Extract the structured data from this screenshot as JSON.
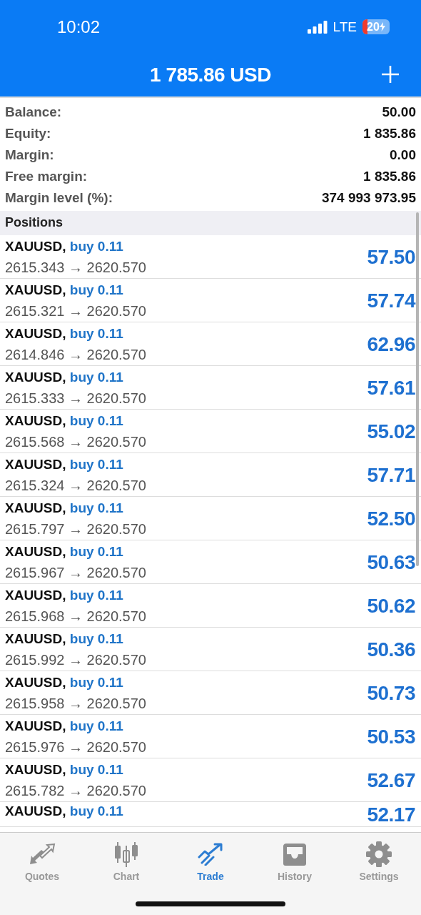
{
  "status_bar": {
    "time": "10:02",
    "network": "LTE",
    "battery": "20"
  },
  "header": {
    "title": "1 785.86 USD"
  },
  "account": [
    {
      "label": "Balance:",
      "value": "50.00"
    },
    {
      "label": "Equity:",
      "value": "1 835.86"
    },
    {
      "label": "Margin:",
      "value": "0.00"
    },
    {
      "label": "Free margin:",
      "value": "1 835.86"
    },
    {
      "label": "Margin level (%):",
      "value": "374 993 973.95"
    }
  ],
  "positions": {
    "title": "Positions",
    "items": [
      {
        "symbol": "XAUUSD,",
        "side": "buy 0.11",
        "prices": "2615.343 → 2620.570",
        "profit": "57.50"
      },
      {
        "symbol": "XAUUSD,",
        "side": "buy 0.11",
        "prices": "2615.321 → 2620.570",
        "profit": "57.74"
      },
      {
        "symbol": "XAUUSD,",
        "side": "buy 0.11",
        "prices": "2614.846 → 2620.570",
        "profit": "62.96"
      },
      {
        "symbol": "XAUUSD,",
        "side": "buy 0.11",
        "prices": "2615.333 → 2620.570",
        "profit": "57.61"
      },
      {
        "symbol": "XAUUSD,",
        "side": "buy 0.11",
        "prices": "2615.568 → 2620.570",
        "profit": "55.02"
      },
      {
        "symbol": "XAUUSD,",
        "side": "buy 0.11",
        "prices": "2615.324 → 2620.570",
        "profit": "57.71"
      },
      {
        "symbol": "XAUUSD,",
        "side": "buy 0.11",
        "prices": "2615.797 → 2620.570",
        "profit": "52.50"
      },
      {
        "symbol": "XAUUSD,",
        "side": "buy 0.11",
        "prices": "2615.967 → 2620.570",
        "profit": "50.63"
      },
      {
        "symbol": "XAUUSD,",
        "side": "buy 0.11",
        "prices": "2615.968 → 2620.570",
        "profit": "50.62"
      },
      {
        "symbol": "XAUUSD,",
        "side": "buy 0.11",
        "prices": "2615.992 → 2620.570",
        "profit": "50.36"
      },
      {
        "symbol": "XAUUSD,",
        "side": "buy 0.11",
        "prices": "2615.958 → 2620.570",
        "profit": "50.73"
      },
      {
        "symbol": "XAUUSD,",
        "side": "buy 0.11",
        "prices": "2615.976 → 2620.570",
        "profit": "50.53"
      },
      {
        "symbol": "XAUUSD,",
        "side": "buy 0.11",
        "prices": "2615.782 → 2620.570",
        "profit": "52.67"
      },
      {
        "symbol": "XAUUSD,",
        "side": "buy 0.11",
        "profit": "52.17"
      }
    ]
  },
  "tabs": [
    {
      "label": "Quotes",
      "selected": false
    },
    {
      "label": "Chart",
      "selected": false
    },
    {
      "label": "Trade",
      "selected": true
    },
    {
      "label": "History",
      "selected": false
    },
    {
      "label": "Settings",
      "selected": false
    }
  ]
}
